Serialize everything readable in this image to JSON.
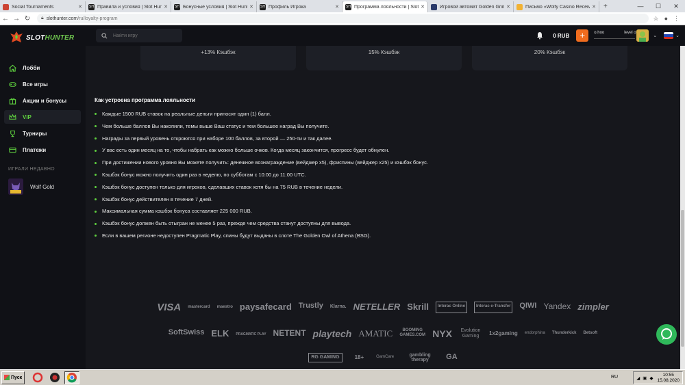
{
  "browser": {
    "tabs": [
      {
        "title": "Social Tournaments",
        "favicon": "social-tournaments-favicon",
        "active": false
      },
      {
        "title": "Правила и условия | Slot Hunter",
        "favicon": "slothunter-favicon",
        "active": false
      },
      {
        "title": "Бонусные условия | Slot Hunter",
        "favicon": "slothunter-favicon",
        "active": false
      },
      {
        "title": "Профиль Игрока",
        "favicon": "slothunter-favicon",
        "active": false
      },
      {
        "title": "Программа лояльности | Slot Hunter",
        "favicon": "slothunter-favicon",
        "active": true
      },
      {
        "title": "Игровой автомат Golden Grimoire",
        "favicon": "casino-favicon",
        "active": false
      },
      {
        "title": "Письмо «Wolfy Casino Received",
        "favicon": "mail-favicon",
        "active": false
      }
    ],
    "url_host": "slothunter.com",
    "url_path": "/ru/loyalty-program"
  },
  "site": {
    "logo_primary": "SLOT",
    "logo_secondary": "HUNTER",
    "search_placeholder": "Найти игру",
    "balance": "0 RUB",
    "plus_label": "+",
    "username": "o.hoo",
    "level": "level o",
    "accent_color": "#5fd13f",
    "deposit_color": "#f06c1e"
  },
  "sidebar": {
    "items": [
      {
        "label": "Лобби",
        "icon": "home-icon",
        "active": false
      },
      {
        "label": "Все игры",
        "icon": "gamepad-icon",
        "active": false
      },
      {
        "label": "Акции и бонусы",
        "icon": "gift-icon",
        "active": false
      },
      {
        "label": "VIP",
        "icon": "crown-icon",
        "active": true
      },
      {
        "label": "Турниры",
        "icon": "trophy-icon",
        "active": false
      },
      {
        "label": "Платежи",
        "icon": "wallet-icon",
        "active": false
      }
    ],
    "recent_title": "ИГРАЛИ НЕДАВНО",
    "recent_game": "Wolf Gold"
  },
  "cashback_cards": [
    "+13% Кэшбэк",
    "15% Кэшбэк",
    "20% Кэшбэк"
  ],
  "loyalty": {
    "title": "Как устроена программа лояльности",
    "rules": [
      "Каждые 1500 RUB ставок на реальные деньги приносят один (1) балл.",
      "Чем больше баллов Вы накопили, темы выше Ваш статус и тем большее наград Вы получите.",
      "Награды за первый уровень откроются при наборе 100 баллов, за второй — 250-ти и так далее.",
      "У вас есть один месяц на то, чтобы набрать как можно больше очков. Когда месяц закончится, прогресс будет обнулен.",
      "При достижении нового уровня Вы можете получить: денежное вознаграждение (вейджер x5), фриспины (вейджер x25) и кэшбэк бонус.",
      "Кэшбэк бонус можно получить один раз в неделю, по субботам с 10:00 до 11:00 UTC.",
      "Кэшбэк бонус доступен только для игроков, сделавших ставок хотя бы на 75 RUB в течение недели.",
      "Кэшбэк бонус действителен в течение 7 дней.",
      "Максимальная сумма кэшбэк бонуса составляет 225 000 RUB.",
      "Кэшбэк бонус должен быть отыгран не менее 5 раз, прежде чем средства станут доступны для вывода.",
      "Если в вашем регионе недоступен Pragmatic Play, спины будут выданы в слоте The Golden Owl of Athena (BSG)."
    ]
  },
  "payment_logos": [
    "VISA",
    "mastercard",
    "maestro",
    "paysafecard",
    "Trustly",
    "Klarna.",
    "NETELLER",
    "Skrill",
    "Interac Online",
    "Interac e-Transfer",
    "QIWI",
    "Yandex",
    "zimpler"
  ],
  "provider_logos": [
    "SoftSwiss",
    "ELK",
    "PRAGMATIC PLAY",
    "NETENT",
    "playtech",
    "AMATIC",
    "BOOMING GAMES.COM",
    "NYX",
    "Evolution Gaming",
    "1x2gaming",
    "endorphina",
    "Thunderkick",
    "Betsoft"
  ],
  "responsible_logos": [
    "RG GAMING",
    "18+",
    "GamCare",
    "gambling therapy",
    "GA"
  ],
  "taskbar": {
    "start_label": "Пуск",
    "lang": "RU",
    "time": "10:55",
    "date": "15.08.2020"
  }
}
